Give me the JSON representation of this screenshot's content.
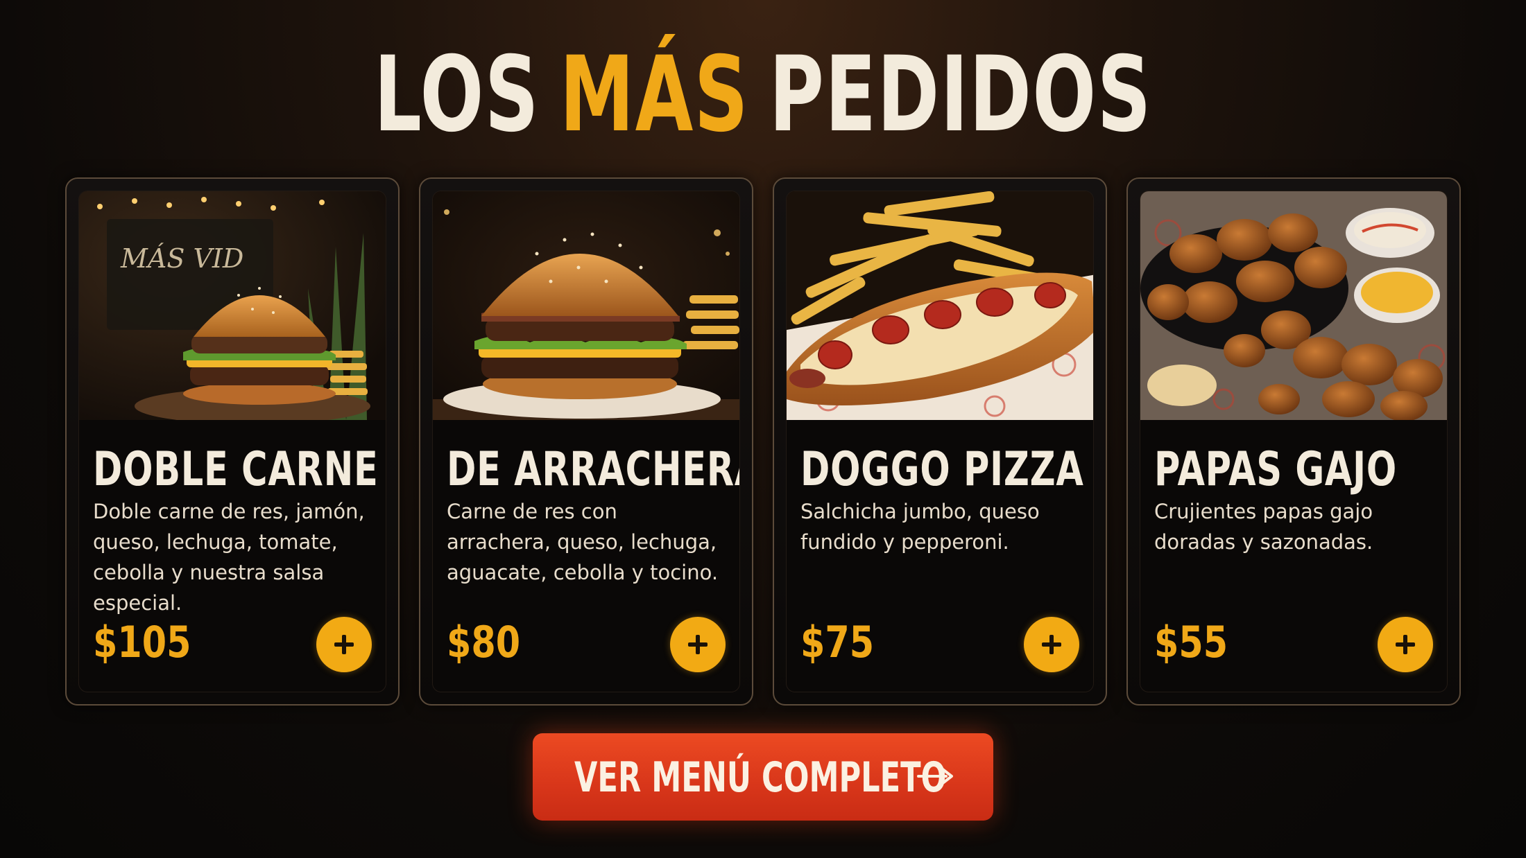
{
  "header": {
    "title_part1": "LOS",
    "title_part2": "MÁS",
    "title_part3": "PEDIDOS"
  },
  "colors": {
    "accent": "#f0a818",
    "cta": "#d8361a",
    "background": "#0d0a08",
    "text": "#f3ebdc"
  },
  "cards": [
    {
      "name": "DOBLE CARNE",
      "description": "Doble carne de res, jamón, queso, lechuga, tomate, cebolla y nuestra salsa especial.",
      "price": "$105",
      "add_icon": "plus-icon",
      "photo_sign_text": "MÁS VID"
    },
    {
      "name": "DE ARRACHERA",
      "description": "Carne de res con arrachera, queso, lechuga, aguacate, cebolla y tocino.",
      "price": "$80",
      "add_icon": "plus-icon"
    },
    {
      "name": "DOGGO PIZZA",
      "description": "Salchicha jumbo, queso fundido y pepperoni.",
      "price": "$75",
      "add_icon": "plus-icon"
    },
    {
      "name": "PAPAS GAJO",
      "description": "Crujientes papas gajo doradas y sazonadas.",
      "price": "$55",
      "add_icon": "plus-icon"
    }
  ],
  "cta": {
    "label": "VER MENÚ COMPLETO",
    "icon": "arrow-right-icon"
  }
}
